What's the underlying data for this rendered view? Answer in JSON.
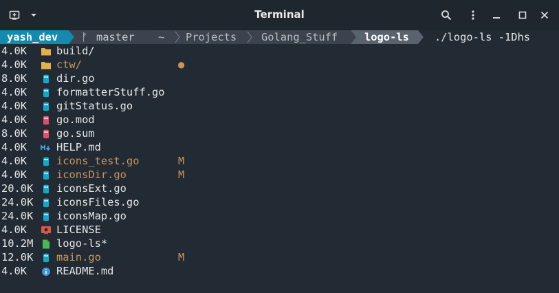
{
  "window": {
    "title": "Terminal"
  },
  "prompt": {
    "user": "yash_dev",
    "branch_symbol": "ᚠ",
    "branch": "master",
    "path": [
      "~",
      "Projects",
      "Golang_Stuff"
    ],
    "cwd": "logo-ls",
    "command": "./logo-ls -1Dhs"
  },
  "files": [
    {
      "size": "4.0K",
      "name": "build/",
      "icon": "folder-icon",
      "status": ""
    },
    {
      "size": "4.0K",
      "name": "ctw/",
      "icon": "folder-icon",
      "status": "●"
    },
    {
      "size": "8.0K",
      "name": "dir.go",
      "icon": "go-gopher-icon",
      "status": ""
    },
    {
      "size": "4.0K",
      "name": "formatterStuff.go",
      "icon": "go-gopher-icon",
      "status": ""
    },
    {
      "size": "4.0K",
      "name": "gitStatus.go",
      "icon": "go-gopher-icon",
      "status": ""
    },
    {
      "size": "4.0K",
      "name": "go.mod",
      "icon": "go-mod-icon",
      "status": ""
    },
    {
      "size": "8.0K",
      "name": "go.sum",
      "icon": "go-mod-icon",
      "status": ""
    },
    {
      "size": "4.0K",
      "name": "HELP.md",
      "icon": "markdown-icon",
      "status": ""
    },
    {
      "size": "4.0K",
      "name": "icons_test.go",
      "icon": "go-gopher-icon",
      "status": "M"
    },
    {
      "size": "4.0K",
      "name": "iconsDir.go",
      "icon": "go-gopher-icon",
      "status": "M"
    },
    {
      "size": "20.0K",
      "name": "iconsExt.go",
      "icon": "go-gopher-icon",
      "status": ""
    },
    {
      "size": "24.0K",
      "name": "iconsFiles.go",
      "icon": "go-gopher-icon",
      "status": ""
    },
    {
      "size": "24.0K",
      "name": "iconsMap.go",
      "icon": "go-gopher-icon",
      "status": ""
    },
    {
      "size": "4.0K",
      "name": "LICENSE",
      "icon": "license-icon",
      "status": ""
    },
    {
      "size": "10.2M",
      "name": "logo-ls*",
      "icon": "executable-file-icon",
      "status": ""
    },
    {
      "size": "12.0K",
      "name": "main.go",
      "icon": "go-gopher-icon",
      "status": "M"
    },
    {
      "size": "4.0K",
      "name": "README.md",
      "icon": "info-icon",
      "status": ""
    }
  ],
  "colors": {
    "background": "#222b34",
    "user_segment": "#138aae",
    "branch_segment": "#3b444e",
    "path_segment": "#3b444e",
    "cwd_segment": "#5a636d",
    "modified": "#c8965a",
    "folder": "#e8b04a",
    "go": "#12a8c8",
    "go_mod": "#e04e6a",
    "license": "#e0574a",
    "executable": "#4cb854",
    "info": "#3d94e0"
  }
}
